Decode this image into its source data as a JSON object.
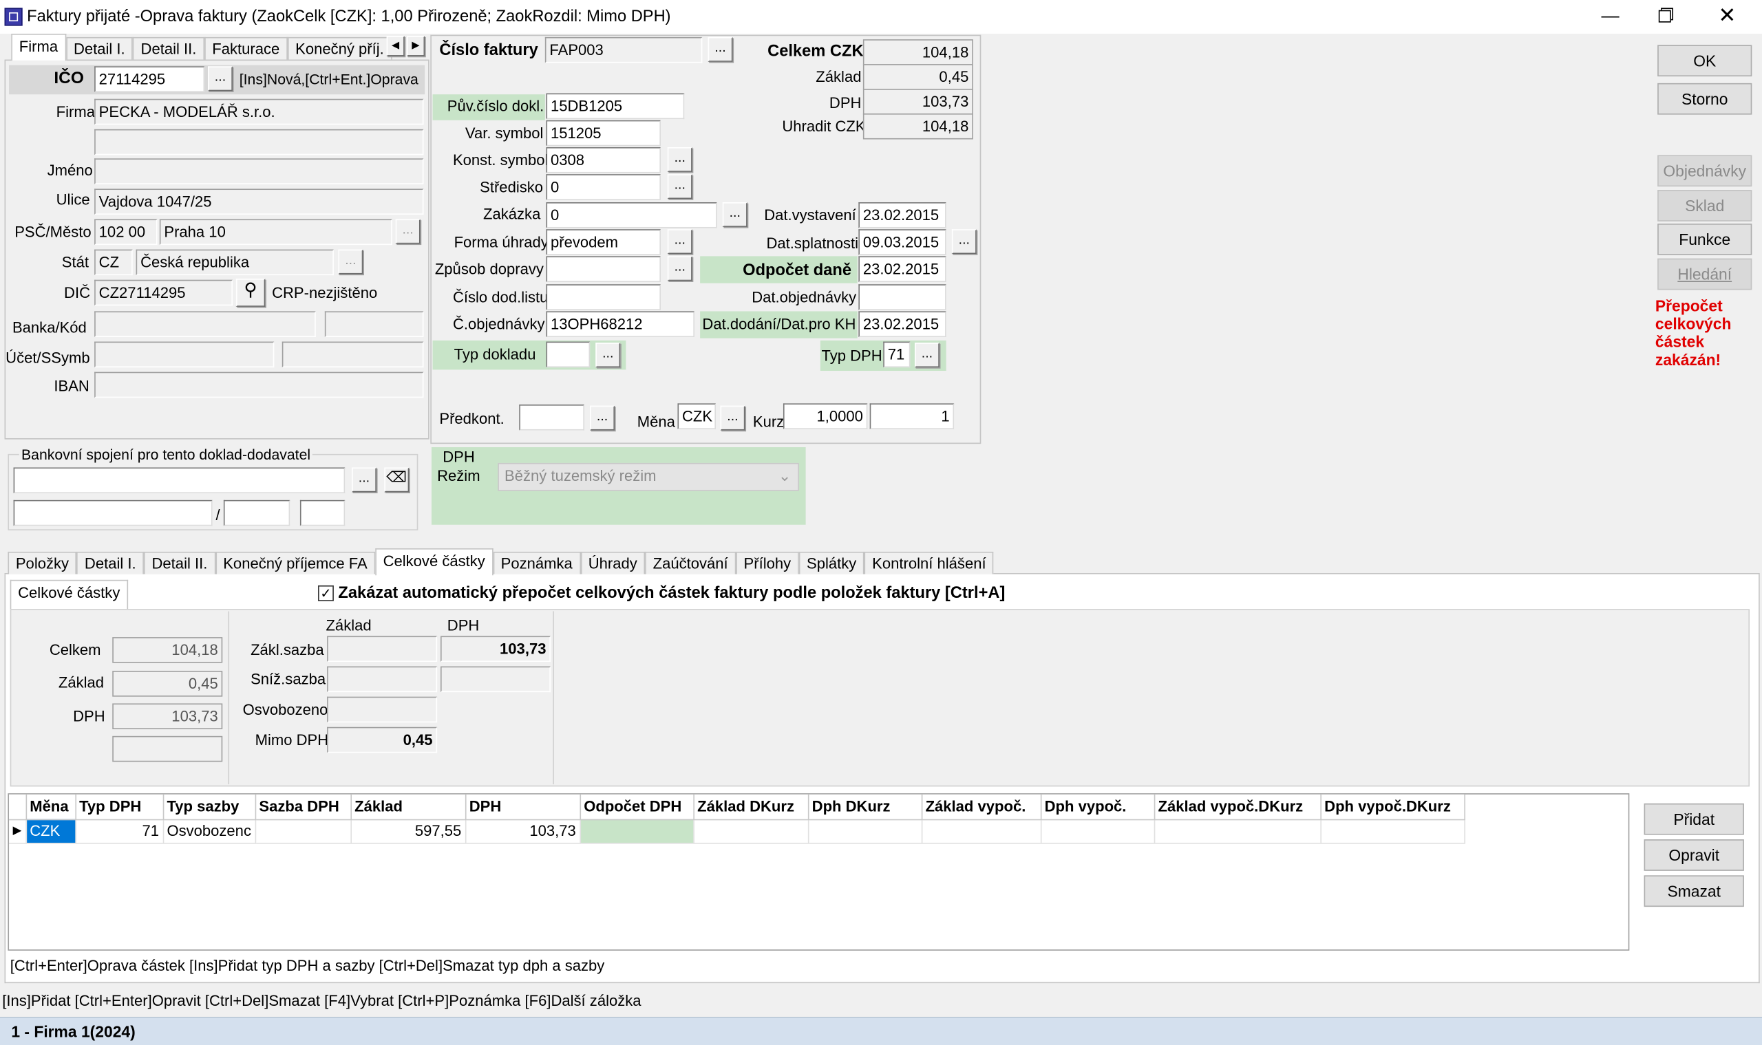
{
  "window": {
    "title": "Faktury přijaté -Oprava faktury  (ZaokCelk [CZK]: 1,00 Přirozeně; ZaokRozdil: Mimo DPH)"
  },
  "top_tabs": [
    "Firma",
    "Detail I.",
    "Detail II.",
    "Fakturace",
    "Konečný příj."
  ],
  "firma": {
    "ico_label": "IČO",
    "ico": "27114295",
    "ico_hint": "[Ins]Nová,[Ctrl+Ent.]Oprava",
    "firma_label": "Firma",
    "firma": "PECKA - MODELÁŘ s.r.o.",
    "firma2": "",
    "jmeno_label": "Jméno",
    "jmeno": "",
    "ulice_label": "Ulice",
    "ulice": "Vajdova 1047/25",
    "psc_label": "PSČ/Město",
    "psc": "102 00",
    "mesto": "Praha 10",
    "stat_label": "Stát",
    "stat_kod": "CZ",
    "stat": "Česká republika",
    "dic_label": "DIČ",
    "dic": "CZ27114295",
    "dic_status": "CRP-nezjištěno",
    "banka_label": "Banka/Kód",
    "ucet_label": "Účet/SSymb",
    "iban_label": "IBAN"
  },
  "bank_group": {
    "title": "Bankovní spojení pro tento doklad-dodavatel",
    "slash": "/"
  },
  "doc": {
    "cislo_label": "Číslo faktury",
    "cislo": "FAP003",
    "puv_label": "Pův.číslo dokl.",
    "puv": "15DB1205",
    "var_label": "Var. symbol",
    "var": "151205",
    "konst_label": "Konst. symbol",
    "konst": "0308",
    "stredisko_label": "Středisko",
    "stredisko": "0",
    "zakazka_label": "Zakázka",
    "zakazka": "0",
    "forma_label": "Forma úhrady",
    "forma": "převodem",
    "doprava_label": "Způsob dopravy",
    "doprava": "",
    "dodlist_label": "Číslo dod.listu",
    "dodlist": "",
    "obj_label": "Č.objednávky",
    "obj": "13OPH68212",
    "typdokl_label": "Typ dokladu",
    "typdokl": "",
    "predkont_label": "Předkont.",
    "predkont": "",
    "mena_label": "Měna",
    "mena": "CZK",
    "kurz_label": "Kurz",
    "kurz": "1,0000",
    "kurz2": "1"
  },
  "totals": {
    "celkem_label": "Celkem CZK",
    "celkem": "104,18",
    "zaklad_label": "Základ",
    "zaklad": "0,45",
    "dph_label": "DPH",
    "dph": "103,73",
    "uhradit_label": "Uhradit CZK",
    "uhradit": "104,18"
  },
  "dates": {
    "vystaveni_label": "Dat.vystavení",
    "vystaveni": "23.02.2015",
    "splatnosti_label": "Dat.splatnosti",
    "splatnosti": "09.03.2015",
    "odpocet_label": "Odpočet daně",
    "odpocet": "23.02.2015",
    "objednavky_label": "Dat.objednávky",
    "objednavky": "",
    "dodani_label": "Dat.dodání/Dat.pro KH",
    "dodani": "23.02.2015",
    "typdph_label": "Typ DPH",
    "typdph": "71"
  },
  "dph_regime": {
    "label1": "DPH",
    "label2": "Režim",
    "value": "Běžný tuzemský režim"
  },
  "side_buttons": {
    "ok": "OK",
    "storno": "Storno",
    "objednavky": "Objednávky",
    "sklad": "Sklad",
    "funkce": "Funkce",
    "hledani": "Hledání",
    "warning": "Přepočet celkových částek zakázán!"
  },
  "bottom_tabs": [
    "Položky",
    "Detail I.",
    "Detail II.",
    "Konečný příjemce FA",
    "Celkové částky",
    "Poznámka",
    "Úhrady",
    "Zaúčtování",
    "Přílohy",
    "Splátky",
    "Kontrolní hlášení"
  ],
  "celk": {
    "subtab": "Celkové částky",
    "checkbox_label": "Zakázat automatický přepočet celkových částek faktury podle položek faktury [Ctrl+A]",
    "celkem_label": "Celkem",
    "celkem": "104,18",
    "zaklad_label": "Základ",
    "zaklad": "0,45",
    "dph_label": "DPH",
    "dph": "103,73",
    "col_zaklad": "Základ",
    "col_dph": "DPH",
    "zakl_sazba_label": "Zákl.sazba",
    "zakl_sazba_dph": "103,73",
    "sniz_sazba_label": "Sníž.sazba",
    "osvobozeno_label": "Osvobozeno",
    "mimo_label": "Mimo DPH",
    "mimo": "0,45"
  },
  "grid": {
    "columns": [
      "Měna",
      "Typ DPH",
      "Typ sazby",
      "Sazba DPH",
      "Základ",
      "DPH",
      "Odpočet DPH",
      "Základ DKurz",
      "Dph DKurz",
      "Základ vypoč.",
      "Dph vypoč.",
      "Základ vypoč.DKurz",
      "Dph vypoč.DKurz"
    ],
    "rows": [
      {
        "mena": "CZK",
        "typ_dph": "71",
        "typ_sazby": "Osvobozenc",
        "sazba": "",
        "zaklad": "597,55",
        "dph": "103,73"
      }
    ]
  },
  "grid_buttons": {
    "pridat": "Přidat",
    "opravit": "Opravit",
    "smazat": "Smazat"
  },
  "hint1": "[Ctrl+Enter]Oprava částek [Ins]Přidat typ DPH a sazby [Ctrl+Del]Smazat typ dph a sazby",
  "hint2": "[Ins]Přidat [Ctrl+Enter]Opravit [Ctrl+Del]Smazat [F4]Vybrat [Ctrl+P]Poznámka [F6]Další záložka",
  "statusbar": "1 - Firma 1(2024)"
}
